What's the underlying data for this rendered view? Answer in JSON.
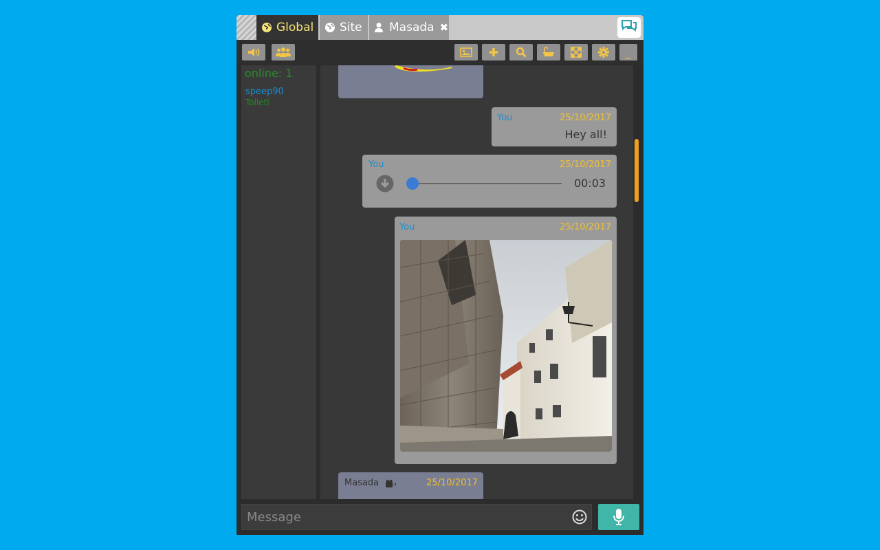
{
  "tabs": [
    {
      "label": "Global",
      "icon": "globe-icon",
      "active": true
    },
    {
      "label": "Site",
      "icon": "globe-icon",
      "active": false
    },
    {
      "label": "Masada",
      "icon": "user-icon",
      "active": false,
      "closable": true
    }
  ],
  "toolbar": {
    "left_buttons": [
      "speaker-icon",
      "users-icon"
    ],
    "right_buttons": [
      "image-icon",
      "plus-icon",
      "search-icon",
      "bath-icon",
      "expand-icon",
      "gear-icon",
      "minimize-icon"
    ],
    "minimize_label": "_"
  },
  "users_panel": {
    "online_label": "online: 1",
    "users": [
      {
        "name": "speep90",
        "status": "Tolleti"
      }
    ]
  },
  "messages": [
    {
      "type": "sticker",
      "author": "",
      "date": ""
    },
    {
      "type": "text",
      "author": "You",
      "date": "25/10/2017",
      "text": "Hey all!"
    },
    {
      "type": "audio",
      "author": "You",
      "date": "25/10/2017",
      "duration": "00:03",
      "progress": 0.0
    },
    {
      "type": "image",
      "author": "You",
      "date": "25/10/2017",
      "alt": "photo of old church and buildings"
    },
    {
      "type": "text",
      "author": "Masada",
      "date": "25/10/2017",
      "author_icon": "video-off-icon"
    }
  ],
  "input": {
    "placeholder": "Message"
  },
  "colors": {
    "background": "#00aaee",
    "author": "#1a8fd0",
    "date": "#f0c030",
    "online": "#2e8b2e",
    "accent_active_tab": "#f7e57a",
    "scroll_thumb": "#f0a020",
    "mic_button": "#3fb6a8"
  }
}
